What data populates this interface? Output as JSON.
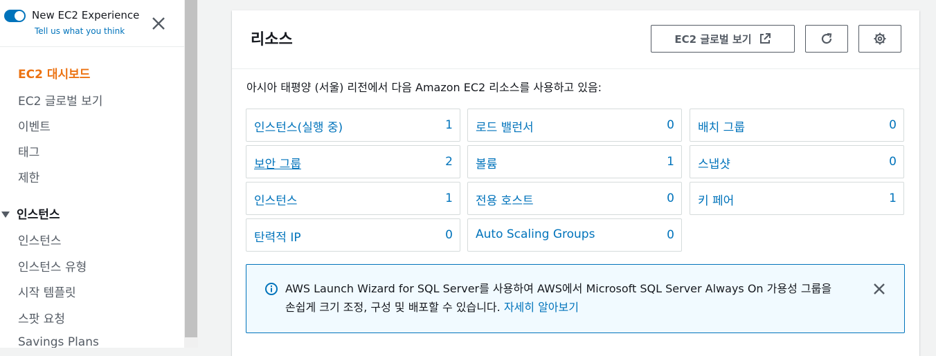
{
  "sidebar": {
    "experience_toggle_title": "New EC2 Experience",
    "experience_feedback": "Tell us what you think",
    "items": [
      {
        "label": "EC2 대시보드"
      },
      {
        "label": "EC2 글로벌 보기"
      },
      {
        "label": "이벤트"
      },
      {
        "label": "태그"
      },
      {
        "label": "제한"
      }
    ],
    "section_instances": "인스턴스",
    "instances_items": [
      {
        "label": "인스턴스"
      },
      {
        "label": "인스턴스 유형"
      },
      {
        "label": "시작 템플릿"
      },
      {
        "label": "스팟 요청"
      },
      {
        "label": "Savings Plans"
      }
    ]
  },
  "panel": {
    "title": "리소스",
    "global_view_button": "EC2 글로벌 보기",
    "region_text": "아시아 태평양 (서울) 리전에서 다음 Amazon EC2 리소스를 사용하고 있음:",
    "resources": [
      {
        "label": "인스턴스(실행 중)",
        "count": "1"
      },
      {
        "label": "로드 밸런서",
        "count": "0"
      },
      {
        "label": "배치 그룹",
        "count": "0"
      },
      {
        "label": "보안 그룹",
        "count": "2"
      },
      {
        "label": "볼륨",
        "count": "1"
      },
      {
        "label": "스냅샷",
        "count": "0"
      },
      {
        "label": "인스턴스",
        "count": "1"
      },
      {
        "label": "전용 호스트",
        "count": "0"
      },
      {
        "label": "키 페어",
        "count": "1"
      },
      {
        "label": "탄력적 IP",
        "count": "0"
      },
      {
        "label": "Auto Scaling Groups",
        "count": "0"
      }
    ],
    "info": {
      "text_line1": "AWS Launch Wizard for SQL Server를 사용하여 AWS에서 Microsoft SQL Server Always On 가용성 그룹을",
      "text_line2": "손쉽게 크기 조정, 구성 및 배포할 수 있습니다. ",
      "link": "자세히 알아보기"
    }
  },
  "colors": {
    "link": "#0073bb",
    "active_nav": "#ec7211",
    "text": "#16191f"
  }
}
